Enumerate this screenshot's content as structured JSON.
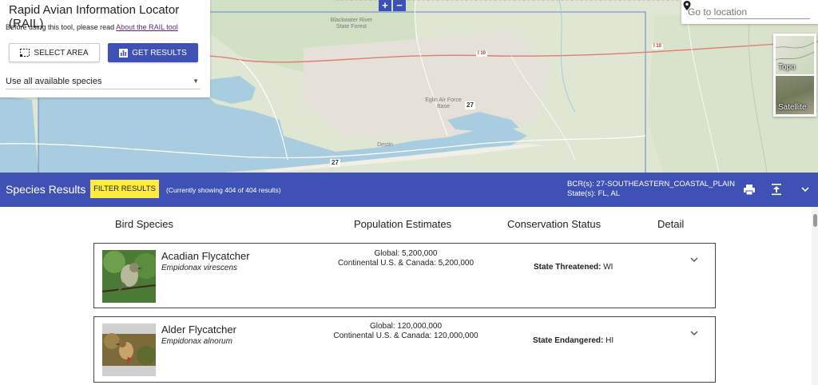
{
  "panel": {
    "title": "Rapid Avian Information Locator (RAIL)",
    "intro_prefix": "Before using this tool, please read ",
    "intro_link": "About the RAIL tool",
    "select_area_label": "SELECT AREA",
    "get_results_label": "GET RESULTS",
    "species_option": "Use all available species"
  },
  "map": {
    "zoom_in": "+",
    "zoom_out": "−",
    "search_placeholder": "Go to location",
    "basemaps": [
      "Topo",
      "Satellite"
    ],
    "labels": {
      "forest": "Blackwater River State Forest",
      "air_base": "Eglin Air Force Base",
      "hwy_27_a": "27",
      "hwy_27_b": "27",
      "i10_a": "I 10",
      "i10_b": "I 10",
      "destin": "Destin"
    }
  },
  "results": {
    "title": "Species Results",
    "filter_label": "FILTER RESULTS",
    "count_text": "(Currently showing 404 of 404 results)",
    "bcr_line": "BCR(s): 27-SOUTHEASTERN_COASTAL_PLAIN",
    "state_line": "State(s): FL, AL"
  },
  "table": {
    "headers": {
      "species": "Bird Species",
      "population": "Population Estimates",
      "conservation": "Conservation Status",
      "detail": "Detail"
    },
    "rows": [
      {
        "common_name": "Acadian Flycatcher",
        "scientific_name": "Empidonax virescens",
        "global_pop": "Global: 5,200,000",
        "continental_pop": "Continental U.S. & Canada: 5,200,000",
        "status_label": "State Threatened:",
        "status_value": " WI"
      },
      {
        "common_name": "Alder Flycatcher",
        "scientific_name": "Empidonax alnorum",
        "global_pop": "Global: 120,000,000",
        "continental_pop": "Continental U.S. & Canada: 120,000,000",
        "status_label": "State Endangered:",
        "status_value": " HI"
      }
    ]
  },
  "colors": {
    "primary": "#3f51b5",
    "filter_highlight": "#ffeb3b",
    "link": "#5b2a86"
  }
}
